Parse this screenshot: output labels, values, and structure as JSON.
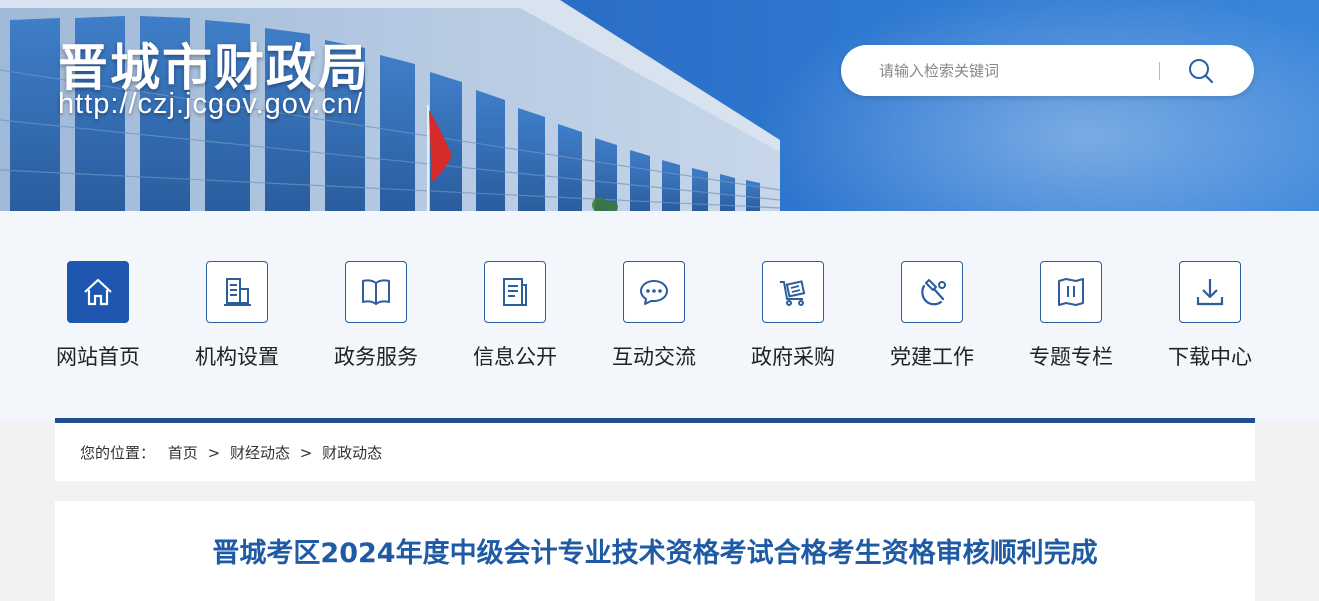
{
  "header": {
    "site_title": "晋城市财政局",
    "site_url": "http://czj.jcgov.gov.cn/",
    "search": {
      "placeholder": "请输入检索关键词",
      "value": ""
    }
  },
  "nav": {
    "items": [
      {
        "label": "网站首页",
        "icon": "home-icon",
        "active": true
      },
      {
        "label": "机构设置",
        "icon": "building-icon"
      },
      {
        "label": "政务服务",
        "icon": "book-icon"
      },
      {
        "label": "信息公开",
        "icon": "document-icon"
      },
      {
        "label": "互动交流",
        "icon": "chat-icon"
      },
      {
        "label": "政府采购",
        "icon": "cart-icon"
      },
      {
        "label": "党建工作",
        "icon": "party-emblem-icon"
      },
      {
        "label": "专题专栏",
        "icon": "column-icon"
      },
      {
        "label": "下载中心",
        "icon": "download-icon"
      }
    ],
    "accent_color": "#1e56b0"
  },
  "breadcrumb": {
    "prefix": "您的位置：",
    "items": [
      "首页",
      "财经动态",
      "财政动态"
    ],
    "separator": ">"
  },
  "article": {
    "title": "晋城考区2024年度中级会计专业技术资格考试合格考生资格审核顺利完成"
  }
}
